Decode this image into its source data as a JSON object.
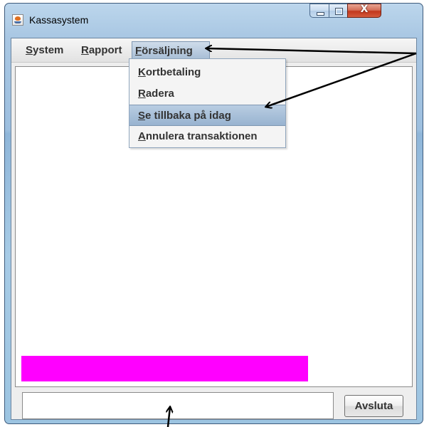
{
  "window": {
    "title": "Kassasystem",
    "icon": "java-cup-icon",
    "controls": {
      "minimize": "minimize-icon",
      "maximize": "maximize-icon",
      "close": "close-icon",
      "close_glyph": "X"
    }
  },
  "menubar": {
    "items": [
      {
        "mnemonic": "S",
        "rest": "ystem",
        "open": false
      },
      {
        "mnemonic": "R",
        "rest": "apport",
        "open": false
      },
      {
        "mnemonic": "F",
        "rest": "örsäljning",
        "open": true
      }
    ]
  },
  "dropdown": {
    "items": [
      {
        "mnemonic": "K",
        "rest": "ortbetaling",
        "highlighted": false
      },
      {
        "mnemonic": "R",
        "rest": "adera",
        "highlighted": false
      },
      {
        "mnemonic": "S",
        "rest": "e tillbaka på idag",
        "highlighted": true
      },
      {
        "mnemonic": "A",
        "rest": "nnulera transaktionen",
        "highlighted": false
      }
    ]
  },
  "bottom": {
    "exit_label": "Avsluta",
    "highlight_color": "#ff00ff"
  },
  "annotations": {
    "arrow_color": "#000000",
    "arrows": [
      "arrow-to-menu",
      "arrow-to-item",
      "arrow-to-bottom-field"
    ]
  }
}
